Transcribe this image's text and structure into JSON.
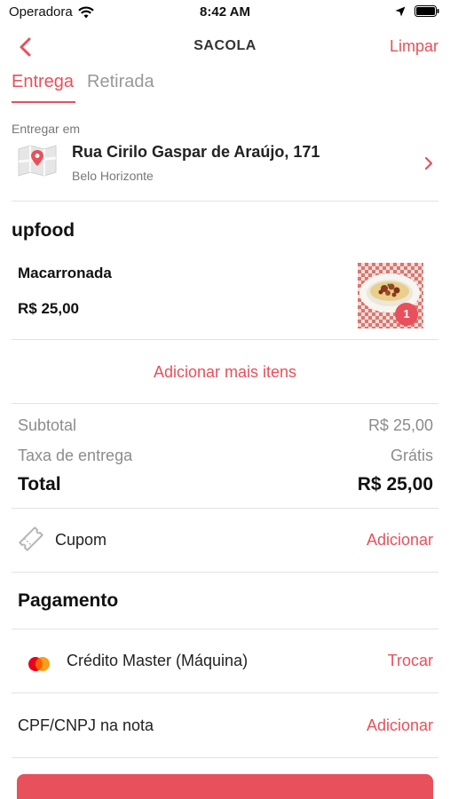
{
  "status_bar": {
    "carrier": "Operadora",
    "time": "8:42 AM"
  },
  "nav": {
    "title": "SACOLA",
    "clear_label": "Limpar",
    "back_icon": "chevron-left-icon"
  },
  "tabs": [
    {
      "label": "Entrega",
      "active": true
    },
    {
      "label": "Retirada",
      "active": false
    }
  ],
  "delivery": {
    "label": "Entregar em",
    "address": "Rua Cirilo Gaspar de Araújo, 171",
    "city": "Belo Horizonte"
  },
  "store": {
    "name": "upfood"
  },
  "cart_item": {
    "name": "Macarronada",
    "price": "R$ 25,00",
    "quantity": "1"
  },
  "add_more_label": "Adicionar mais itens",
  "summary": {
    "subtotal_label": "Subtotal",
    "subtotal_value": "R$ 25,00",
    "delivery_fee_label": "Taxa de entrega",
    "delivery_fee_value": "Grátis",
    "total_label": "Total",
    "total_value": "R$ 25,00"
  },
  "coupon": {
    "label": "Cupom",
    "action": "Adicionar"
  },
  "payment": {
    "title": "Pagamento",
    "method": "Crédito Master (Máquina)",
    "action": "Trocar"
  },
  "tax_id": {
    "label": "CPF/CNPJ na nota",
    "action": "Adicionar"
  },
  "colors": {
    "accent": "#e8505b",
    "muted": "#8c8c8c",
    "divider": "#e3e3e3"
  }
}
